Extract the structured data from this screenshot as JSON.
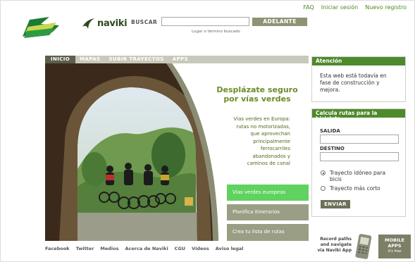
{
  "top_links": [
    "FAQ",
    "Iniciar sesión",
    "Nuevo registro"
  ],
  "brand": {
    "naviki": "naviki"
  },
  "search": {
    "label": "BUSCAR",
    "value": "",
    "placeholder": "",
    "button": "ADELANTE",
    "hint": "Lugar o término buscado"
  },
  "nav": {
    "tabs": [
      "INICIO",
      "MAPAS",
      "SUBIR TRAYECTOS",
      "APPS"
    ]
  },
  "hero": {
    "title_line1": "Desplázate seguro",
    "title_line2": "por vías verdes",
    "body_lines": [
      "Vías verdes en Europa:",
      "rutas no motorizadas,",
      "que aprovechan",
      "principalmente",
      "ferrocarriles",
      "abandonados y",
      "caminos de canal"
    ],
    "links": [
      "Vías verdes europeas",
      "Planifica itinerarios",
      "Crea tu lista de rutas"
    ]
  },
  "attention": {
    "title": "Atención",
    "text_lines": [
      "Esta web está todavía en",
      "fase de construcción y",
      "mejora."
    ]
  },
  "calc": {
    "title": "Calcula rutas para la bicicleta",
    "origin_label": "SALIDA",
    "destination_label": "DESTINO",
    "origin_value": "",
    "destination_value": "",
    "options": [
      {
        "label_lines": [
          "Trayecto idóneo para",
          "bicis"
        ],
        "selected": true
      },
      {
        "label_lines": [
          "Trayecto más corto"
        ],
        "selected": false
      }
    ],
    "submit": "ENVIAR"
  },
  "footer": {
    "links": [
      "Facebook",
      "Twitter",
      "Medios",
      "Acerca de Naviki",
      "CGU",
      "Vídeos",
      "Aviso legal"
    ]
  },
  "promo": {
    "lines": [
      "Record paths",
      "and navigate",
      "via Naviki App"
    ],
    "badge_line1": "MOBILE",
    "badge_line2": "APPS",
    "badge_free": "It's free"
  },
  "colors": {
    "accent_green": "#4e8a2b",
    "olive": "#7d8067",
    "active_link": "#5fd260",
    "tab_bar": "#c9c9bb"
  }
}
